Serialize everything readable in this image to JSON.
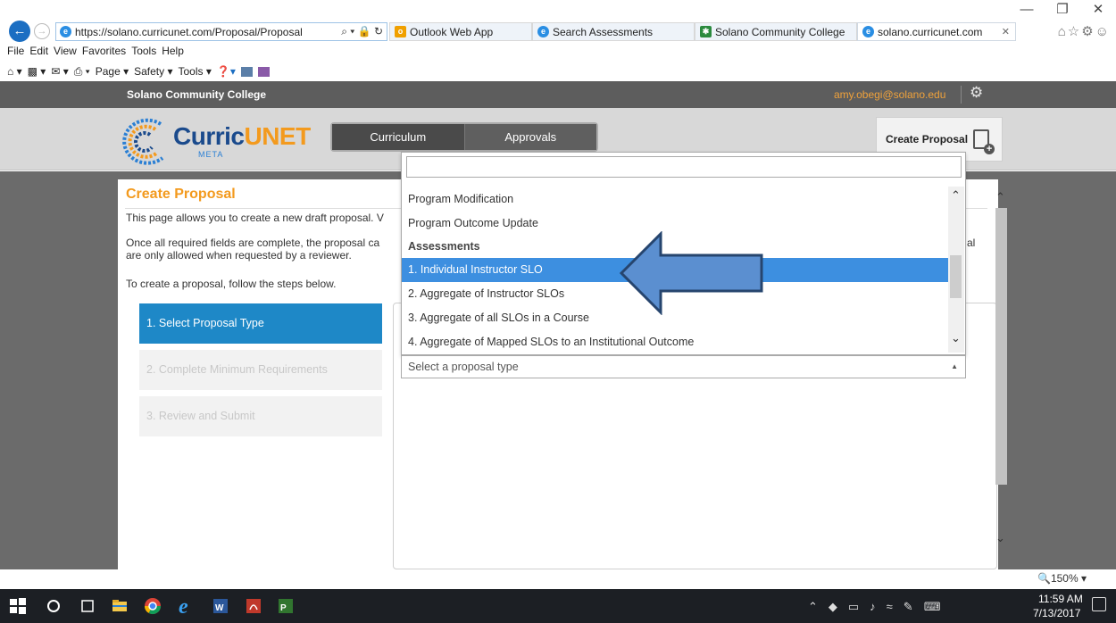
{
  "browser": {
    "url": "https://solano.curricunet.com/Proposal/Proposal",
    "address_icons": "⌕ ▾ 🔒 ↻",
    "tabs": [
      {
        "label": "Outlook Web App",
        "icon": "outlook-icon",
        "color": "#f0a000"
      },
      {
        "label": "Search Assessments",
        "icon": "ie-icon",
        "color": "#2a8ee3"
      },
      {
        "label": "Solano Community College",
        "icon": "palm-icon",
        "color": "#2b8a3e"
      },
      {
        "label": "solano.curricunet.com",
        "icon": "ie-icon",
        "color": "#2a8ee3"
      }
    ],
    "menu": [
      "File",
      "Edit",
      "View",
      "Favorites",
      "Tools",
      "Help"
    ],
    "commands": [
      "Page ▾",
      "Safety ▾",
      "Tools ▾"
    ],
    "zoom": "150%"
  },
  "site": {
    "college": "Solano Community College",
    "user_email": "amy.obegi@solano.edu",
    "logo": {
      "part1": "Curric",
      "part2": "UNET",
      "sub": "META"
    },
    "nav": [
      "Curriculum",
      "Approvals"
    ],
    "create_button": "Create Proposal"
  },
  "page": {
    "title": "Create Proposal",
    "intro1": "This page allows you to create a new draft proposal. V",
    "intro2": "Once all required fields are complete, the proposal ca",
    "intro2_right": "al",
    "intro3": "are only allowed when requested by a reviewer.",
    "intro4": "To create a proposal, follow the steps below.",
    "steps": [
      "1. Select Proposal Type",
      "2. Complete Minimum Requirements",
      "3. Review and Submit"
    ]
  },
  "dropdown": {
    "search_value": "",
    "options": [
      {
        "label": "Program Modification",
        "group": false,
        "selected": false
      },
      {
        "label": "Program Outcome Update",
        "group": false,
        "selected": false
      },
      {
        "label": "Assessments",
        "group": true,
        "selected": false
      },
      {
        "label": "1. Individual Instructor SLO",
        "group": false,
        "selected": true
      },
      {
        "label": "2. Aggregate of Instructor SLOs",
        "group": false,
        "selected": false
      },
      {
        "label": "3. Aggregate of all SLOs in a Course",
        "group": false,
        "selected": false
      },
      {
        "label": "4. Aggregate of Mapped SLOs to an Institutional Outcome",
        "group": false,
        "selected": false
      }
    ],
    "placeholder": "Select a proposal type"
  },
  "taskbar": {
    "time": "11:59 AM",
    "date": "7/13/2017"
  },
  "colors": {
    "accent_orange": "#f39a1e",
    "step_active": "#1e88c7",
    "option_selected": "#3d8fe0",
    "arrow": "#5b8fd0"
  }
}
